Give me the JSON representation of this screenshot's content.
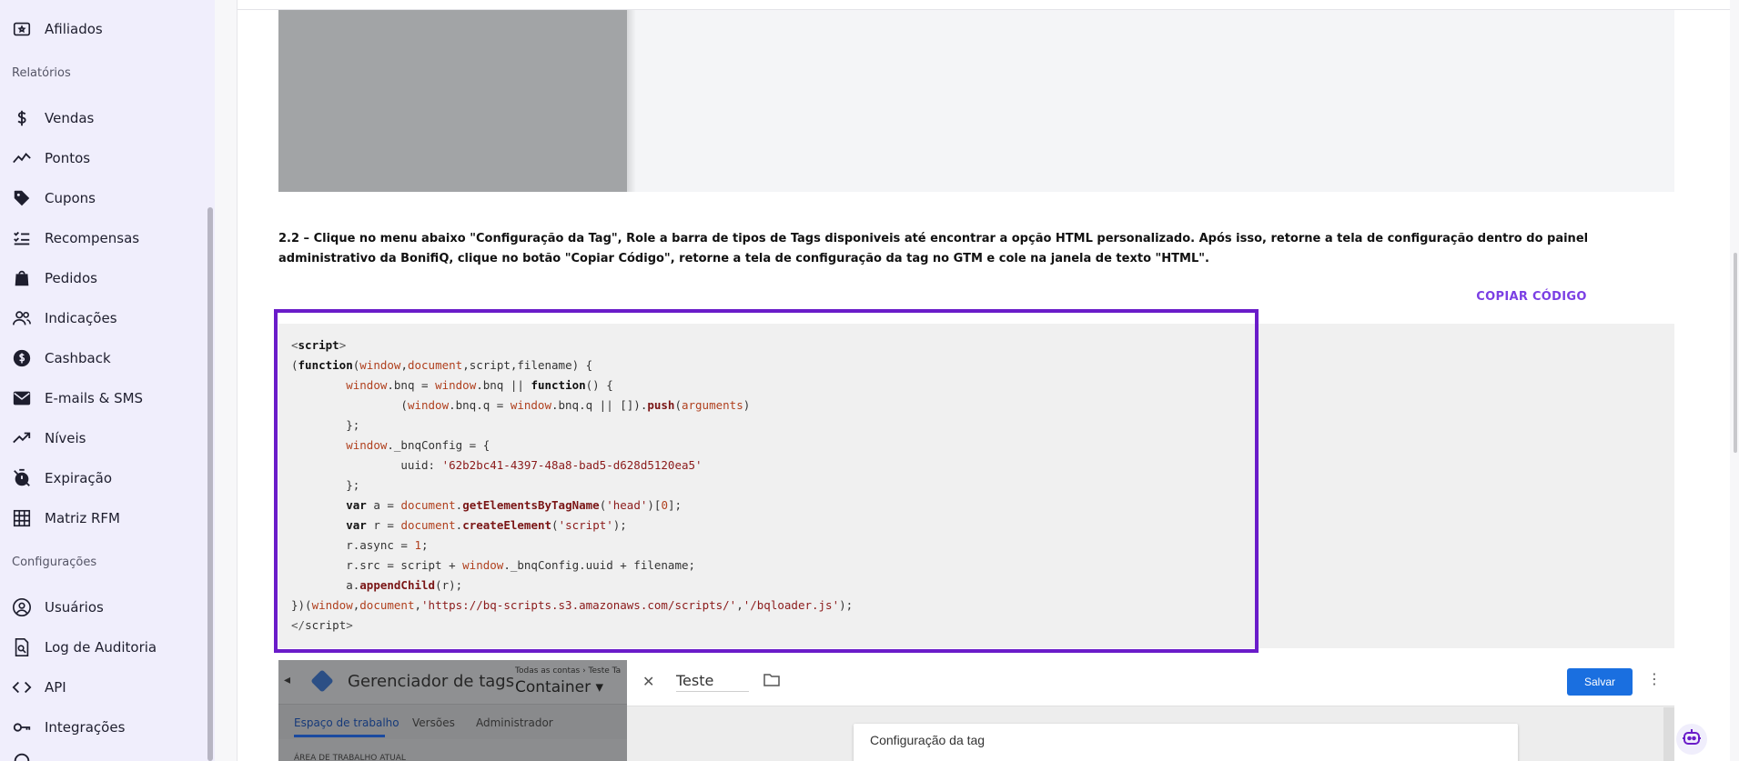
{
  "sidebar": {
    "items_top": [
      {
        "label": "Afiliados",
        "icon": "ticket-star-icon"
      }
    ],
    "section_reports": "Relatórios",
    "items_reports": [
      {
        "label": "Vendas",
        "icon": "dollar-icon"
      },
      {
        "label": "Pontos",
        "icon": "trend-line-icon"
      },
      {
        "label": "Cupons",
        "icon": "tag-icon"
      },
      {
        "label": "Recompensas",
        "icon": "checklist-icon"
      },
      {
        "label": "Pedidos",
        "icon": "shopping-bag-icon"
      },
      {
        "label": "Indicações",
        "icon": "users-icon"
      },
      {
        "label": "Cashback",
        "icon": "coin-dollar-icon"
      },
      {
        "label": "E-mails & SMS",
        "icon": "mail-icon"
      },
      {
        "label": "Níveis",
        "icon": "trending-up-icon"
      },
      {
        "label": "Expiração",
        "icon": "timer-off-icon"
      },
      {
        "label": "Matriz RFM",
        "icon": "grid-icon"
      }
    ],
    "section_config": "Configurações",
    "items_config": [
      {
        "label": "Usuários",
        "icon": "user-circle-icon"
      },
      {
        "label": "Log de Auditoria",
        "icon": "file-search-icon"
      },
      {
        "label": "API",
        "icon": "code-brackets-icon"
      },
      {
        "label": "Integrações",
        "icon": "key-icon"
      }
    ]
  },
  "main": {
    "instruction": "2.2 – Clique no menu abaixo \"Configuração da Tag\", Role a barra de tipos de Tags disponiveis até encontrar a opção HTML personalizado. Após isso, retorne a tela de configuração dentro do painel administrativo da BonifiQ, clique no botão \"Copiar Código\", retorne a tela de configuração da tag no GTM e cole na janela de texto \"HTML\".",
    "copy_button": "COPIAR CÓDIGO",
    "code": {
      "uuid": "'62b2bc41-4397-48a8-bad5-d628d5120ea5'",
      "url": "'https://bq-scripts.s3.amazonaws.com/scripts/'",
      "loader": "'/bqloader.js'"
    },
    "gtm": {
      "app_title": "Gerenciador de tags",
      "breadcrumb": "Todas as contas › Teste Ta",
      "container": "Container ▾",
      "tabs": [
        "Espaço de trabalho",
        "Versões",
        "Administrador"
      ],
      "area_label": "ÁREA DE TRABALHO ATUAL",
      "tag_name": "Teste",
      "save_button": "Salvar",
      "card_title": "Configuração da tag"
    }
  },
  "colors": {
    "sidebar_bg": "#f0eefc",
    "accent_purple": "#7b3fe4",
    "frame_purple": "#6a1cc9",
    "gtm_blue": "#1a6fe0"
  }
}
